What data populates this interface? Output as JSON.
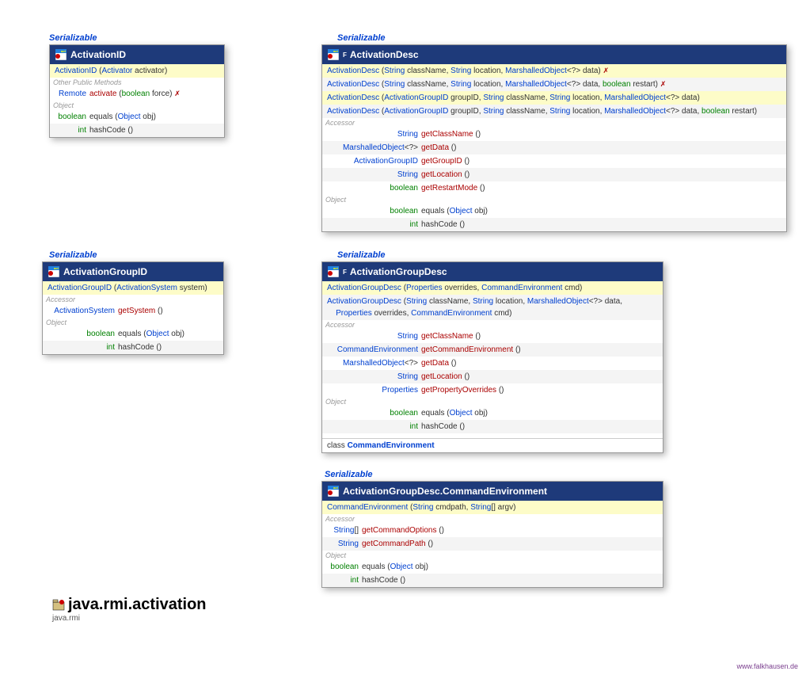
{
  "stereotype": "Serializable",
  "package": {
    "name": "java.rmi.activation",
    "sub": "java.rmi"
  },
  "footer": "www.falkhausen.de",
  "cards": {
    "aid": {
      "title": "ActivationID",
      "ctor": [
        {
          "h": "<span class='tp'>ActivationID</span> (<span class='tp'>Activator</span> activator)"
        }
      ],
      "sects": [
        {
          "label": "Other Public Methods",
          "rows": [
            {
              "ret": "<span class='tp'>Remote</span>",
              "sig": "<span class='meth'>activate</span> (<span class='kw'>boolean</span> force) <span class='mx'>✗</span>"
            }
          ]
        },
        {
          "label": "Object",
          "rows": [
            {
              "ret": "<span class='kw'>boolean</span>",
              "sig": "equals (<span class='tp'>Object</span> obj)"
            },
            {
              "ret": "<span class='kw'>int</span>",
              "sig": "hashCode ()"
            }
          ]
        }
      ]
    },
    "adesc": {
      "title": "ActivationDesc",
      "mod": "F",
      "ctor": [
        {
          "h": "<span class='tp'>ActivationDesc</span> (<span class='tp'>String</span> className, <span class='tp'>String</span> location, <span class='tp'>MarshalledObject</span>&lt;?&gt; data) <span class='mx'>✗</span>"
        },
        {
          "h": "<span class='tp'>ActivationDesc</span> (<span class='tp'>String</span> className, <span class='tp'>String</span> location, <span class='tp'>MarshalledObject</span>&lt;?&gt; data, <span class='kw'>boolean</span> restart) <span class='mx'>✗</span>"
        },
        {
          "h": "<span class='tp'>ActivationDesc</span> (<span class='tp'>ActivationGroupID</span> groupID, <span class='tp'>String</span> className, <span class='tp'>String</span> location, <span class='tp'>MarshalledObject</span>&lt;?&gt; data)"
        },
        {
          "h": "<span class='tp'>ActivationDesc</span> (<span class='tp'>ActivationGroupID</span> groupID, <span class='tp'>String</span> className, <span class='tp'>String</span> location, <span class='tp'>MarshalledObject</span>&lt;?&gt; data, <span class='kw'>boolean</span> restart)"
        }
      ],
      "sects": [
        {
          "label": "Accessor",
          "rw": 115,
          "rows": [
            {
              "ret": "<span class='tp'>String</span>",
              "sig": "<span class='meth'>getClassName</span> ()"
            },
            {
              "ret": "<span class='tp'>MarshalledObject</span>&lt;?&gt;",
              "sig": "<span class='meth'>getData</span> ()"
            },
            {
              "ret": "<span class='tp'>ActivationGroupID</span>",
              "sig": "<span class='meth'>getGroupID</span> ()"
            },
            {
              "ret": "<span class='tp'>String</span>",
              "sig": "<span class='meth'>getLocation</span> ()"
            },
            {
              "ret": "<span class='kw'>boolean</span>",
              "sig": "<span class='meth'>getRestartMode</span> ()"
            }
          ]
        },
        {
          "label": "Object",
          "rw": 115,
          "rows": [
            {
              "ret": "<span class='kw'>boolean</span>",
              "sig": "equals (<span class='tp'>Object</span> obj)"
            },
            {
              "ret": "<span class='kw'>int</span>",
              "sig": "hashCode ()"
            }
          ]
        }
      ]
    },
    "agid": {
      "title": "ActivationGroupID",
      "ctor": [
        {
          "h": "<span class='tp'>ActivationGroupID</span> (<span class='tp'>ActivationSystem</span> system)"
        }
      ],
      "sects": [
        {
          "label": "Accessor",
          "rw": 85,
          "rows": [
            {
              "ret": "<span class='tp'>ActivationSystem</span>",
              "sig": "<span class='meth'>getSystem</span> ()"
            }
          ]
        },
        {
          "label": "Object",
          "rw": 85,
          "rows": [
            {
              "ret": "<span class='kw'>boolean</span>",
              "sig": "equals (<span class='tp'>Object</span> obj)"
            },
            {
              "ret": "<span class='kw'>int</span>",
              "sig": "hashCode ()"
            }
          ]
        }
      ]
    },
    "agdesc": {
      "title": "ActivationGroupDesc",
      "mod": "F",
      "ctor": [
        {
          "h": "<span class='tp'>ActivationGroupDesc</span> (<span class='tp'>Properties</span> overrides, <span class='tp'>CommandEnvironment</span> cmd)"
        },
        {
          "h": "<span class='tp'>ActivationGroupDesc</span> (<span class='tp'>String</span> className, <span class='tp'>String</span> location, <span class='tp'>MarshalledObject</span>&lt;?&gt; data,<br>&nbsp;&nbsp;&nbsp;&nbsp;<span class='tp'>Properties</span> overrides, <span class='tp'>CommandEnvironment</span> cmd)"
        }
      ],
      "sects": [
        {
          "label": "Accessor",
          "rw": 115,
          "rows": [
            {
              "ret": "<span class='tp'>String</span>",
              "sig": "<span class='meth'>getClassName</span> ()"
            },
            {
              "ret": "<span class='tp'>CommandEnvironment</span>",
              "sig": "<span class='meth'>getCommandEnvironment</span> ()"
            },
            {
              "ret": "<span class='tp'>MarshalledObject</span>&lt;?&gt;",
              "sig": "<span class='meth'>getData</span> ()"
            },
            {
              "ret": "<span class='tp'>String</span>",
              "sig": "<span class='meth'>getLocation</span> ()"
            },
            {
              "ret": "<span class='tp'>Properties</span>",
              "sig": "<span class='meth'>getPropertyOverrides</span> ()"
            }
          ]
        },
        {
          "label": "Object",
          "rw": 115,
          "rows": [
            {
              "ret": "<span class='kw'>boolean</span>",
              "sig": "equals (<span class='tp'>Object</span> obj)"
            },
            {
              "ret": "<span class='kw'>int</span>",
              "sig": "hashCode ()"
            }
          ]
        }
      ],
      "nested": {
        "h": "class <span class='tp'><b>CommandEnvironment</b></span>"
      }
    },
    "cmdenv": {
      "title": "ActivationGroupDesc.CommandEnvironment",
      "ctor": [
        {
          "h": "<span class='tp'>CommandEnvironment</span> (<span class='tp'>String</span> cmdpath, <span class='tp'>String</span>[] argv)"
        }
      ],
      "sects": [
        {
          "label": "Accessor",
          "rw": 40,
          "rows": [
            {
              "ret": "<span class='tp'>String</span>[]",
              "sig": "<span class='meth'>getCommandOptions</span> ()"
            },
            {
              "ret": "<span class='tp'>String</span>",
              "sig": "<span class='meth'>getCommandPath</span> ()"
            }
          ]
        },
        {
          "label": "Object",
          "rw": 40,
          "rows": [
            {
              "ret": "<span class='kw'>boolean</span>",
              "sig": "equals (<span class='tp'>Object</span> obj)"
            },
            {
              "ret": "<span class='kw'>int</span>",
              "sig": "hashCode ()"
            }
          ]
        }
      ]
    }
  }
}
